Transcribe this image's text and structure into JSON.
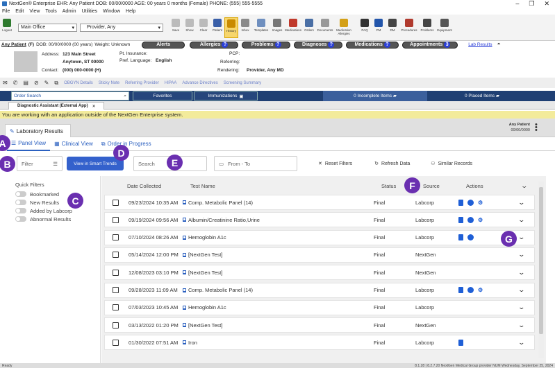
{
  "window": {
    "title": "NextGen® Enterprise EHR: Any Patient  DOB: 00/00/0000  AGE: 00 years 0 months (Female)  PHONE: (555) 555-5555"
  },
  "menu": [
    "File",
    "Edit",
    "View",
    "Tools",
    "Admin",
    "Utilities",
    "Window",
    "Help"
  ],
  "toolbar": {
    "logout": "Logout",
    "location": "Main Office",
    "provider": "Provider, Any",
    "buttons": [
      "Save",
      "Show",
      "Clear",
      "Patient",
      "History",
      "Inbox",
      "Templates",
      "Images",
      "Medications",
      "Orders",
      "Documents",
      "Medication Allergies",
      "PAQ",
      "PM",
      "DM",
      "Procedures",
      "Problems",
      "Equipment"
    ]
  },
  "patient": {
    "name": "Any Patient",
    "sex": "(F)",
    "dob": "DOB: 00/00/0000 (00 years)",
    "weight": "Weight: Unknown",
    "pills": [
      "Alerts",
      "Allergies",
      "Problems",
      "Diagnoses",
      "Medications",
      "Appointments"
    ],
    "badges": [
      "?",
      "?",
      "?",
      "?",
      "3"
    ],
    "lab_link": "Lab Results"
  },
  "demog": {
    "address_label": "Address:",
    "address1": "123 Main Street",
    "address2": "Anytown, ST 00000",
    "contact_label": "Contact:",
    "contact": "(000) 000-0000 (H)",
    "ins_label": "Pt. Insurance:",
    "lang_label": "Pref. Language:",
    "lang": "English",
    "pcp_label": "PCP:",
    "ref_label": "Referring:",
    "rend_label": "Rendering:",
    "rend": "Provider, Any MD"
  },
  "iconrow": [
    "OBGYN Details",
    "Sticky Note",
    "Referring Provider",
    "HIPAA",
    "Advance Directives",
    "Screening Summary"
  ],
  "nav": {
    "order_search": "Order Search",
    "favorites": "Favorites",
    "immunizations": "Immunizations",
    "incomplete": "0 Incomplete Items",
    "placed": "0 Placed Items"
  },
  "apptab": "Diagnostic Assistant (External App)",
  "notice": "You are working with an application outside of the NextGen Enterprise system.",
  "lab": {
    "title": "Laboratory Results",
    "pt_name": "Any Patient",
    "pt_dob": "00/00/0000"
  },
  "views": [
    "Panel View",
    "Clinical View",
    "Order in Progress"
  ],
  "filters": {
    "filter": "Filter",
    "trends": "View in Smart Trends",
    "search": "Search",
    "fromto": "From - To",
    "reset": "Reset Filters",
    "refresh": "Refresh Data",
    "similar": "Similar Records"
  },
  "quick": {
    "title": "Quick Filters",
    "items": [
      "Bookmarked",
      "New Results",
      "Added by Labcorp",
      "Abnormal Results"
    ]
  },
  "columns": {
    "date": "Date Collected",
    "name": "Test Name",
    "status": "Status",
    "source": "Source",
    "actions": "Actions"
  },
  "rows": [
    {
      "date": "09/23/2024 10:35 AM",
      "name": "Comp. Metabolic Panel (14)",
      "status": "Final",
      "source": "Labcorp"
    },
    {
      "date": "09/19/2024 09:56 AM",
      "name": "Albumin/Creatinine Ratio,Urine",
      "status": "Final",
      "source": "Labcorp"
    },
    {
      "date": "07/10/2024 08:26 AM",
      "name": "Hemoglobin A1c",
      "status": "Final",
      "source": "Labcorp"
    },
    {
      "date": "05/14/2024 12:00 PM",
      "name": "[NextGen Test]",
      "status": "Final",
      "source": "NextGen"
    },
    {
      "date": "12/08/2023 03:10 PM",
      "name": "[NextGen Test]",
      "status": "Final",
      "source": "NextGen"
    },
    {
      "date": "09/28/2023 11:09 AM",
      "name": "Comp. Metabolic Panel (14)",
      "status": "Final",
      "source": "Labcorp"
    },
    {
      "date": "07/03/2023 10:45 AM",
      "name": "Hemoglobin A1c",
      "status": "Final",
      "source": "Labcorp"
    },
    {
      "date": "03/13/2022 01:20 PM",
      "name": "[NextGen Test]",
      "status": "Final",
      "source": "NextGen"
    },
    {
      "date": "01/30/2022 07:51 AM",
      "name": "Iron",
      "status": "Final",
      "source": "Labcorp"
    }
  ],
  "status": {
    "left": "Ready",
    "right": "8.1.28 | 8.2.7.20 NextGen Medical Group  provider  NUM  Wednesday, September 25, 2024"
  },
  "markers": [
    "A",
    "B",
    "C",
    "D",
    "E",
    "F",
    "G"
  ]
}
